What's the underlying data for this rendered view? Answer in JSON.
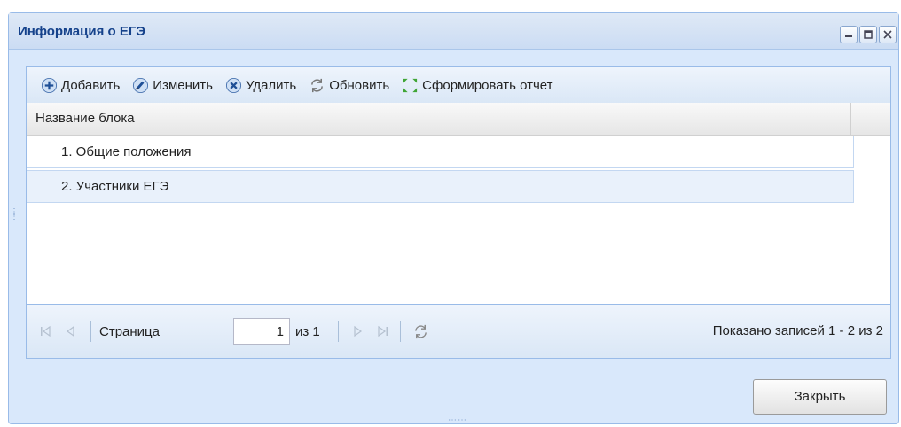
{
  "window": {
    "title": "Информация о ЕГЭ",
    "accent_color": "#15428b",
    "tools": [
      "minimize-icon",
      "maximize-icon",
      "close-icon"
    ]
  },
  "toolbar": {
    "add_label": "Добавить",
    "edit_label": "Изменить",
    "delete_label": "Удалить",
    "refresh_label": "Обновить",
    "report_label": "Сформировать отчет"
  },
  "grid": {
    "column_header": "Название блока",
    "rows": [
      "1. Общие положения",
      "2. Участники ЕГЭ"
    ]
  },
  "pager": {
    "page_label": "Страница",
    "page_value": "1",
    "of_label": "из 1",
    "info": "Показано записей 1 - 2 из 2"
  },
  "footer": {
    "close_label": "Закрыть"
  }
}
